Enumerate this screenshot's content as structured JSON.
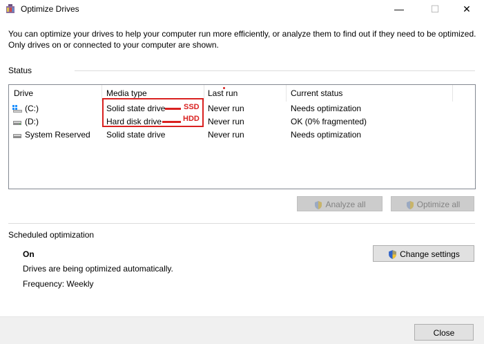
{
  "window": {
    "title": "Optimize Drives",
    "controls": {
      "minimize": "—",
      "maximize": "☐",
      "close": "✕"
    }
  },
  "description": "You can optimize your drives to help your computer run more efficiently, or analyze them to find out if they need to be optimized. Only drives on or connected to your computer are shown.",
  "status": {
    "label": "Status",
    "columns": [
      "Drive",
      "Media type",
      "Last run",
      "Current status"
    ],
    "rows": [
      {
        "drive": "(C:)",
        "media": "Solid state drive",
        "last_run": "Never run",
        "status": "Needs optimization",
        "icon": "windows-drive-icon"
      },
      {
        "drive": "(D:)",
        "media": "Hard disk drive",
        "last_run": "Never run",
        "status": "OK (0% fragmented)",
        "icon": "hard-drive-icon"
      },
      {
        "drive": "System Reserved",
        "media": "Solid state drive",
        "last_run": "Never run",
        "status": "Needs optimization",
        "icon": "hard-drive-icon"
      }
    ],
    "analyze_label": "Analyze all",
    "optimize_label": "Optimize all"
  },
  "annotations": {
    "ssd": "SSD",
    "hdd": "HDD",
    "color": "#d9201f"
  },
  "scheduled": {
    "label": "Scheduled optimization",
    "state": "On",
    "message": "Drives are being optimized automatically.",
    "frequency": "Frequency: Weekly",
    "change_label": "Change settings"
  },
  "footer": {
    "close_label": "Close"
  }
}
